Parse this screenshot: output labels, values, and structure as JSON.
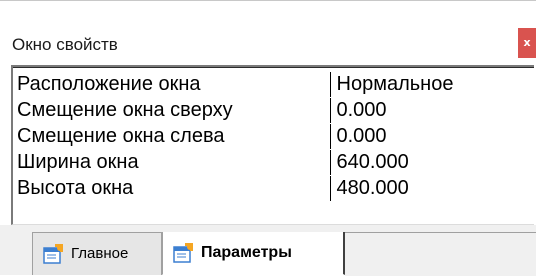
{
  "window": {
    "title": "Окно свойств",
    "close_label": "x"
  },
  "properties": [
    {
      "name": "Расположение окна",
      "value": "Нормальное"
    },
    {
      "name": "Смещение окна сверху",
      "value": "0.000"
    },
    {
      "name": "Смещение окна слева",
      "value": "0.000"
    },
    {
      "name": "Ширина окна",
      "value": "640.000"
    },
    {
      "name": "Высота окна",
      "value": "480.000"
    }
  ],
  "tabs": [
    {
      "label": "Главное",
      "icon": "properties-icon",
      "active": false
    },
    {
      "label": "Параметры",
      "icon": "properties-icon",
      "active": true
    }
  ],
  "colors": {
    "close_button": "#d9534f",
    "icon_orange": "#f5a623",
    "icon_blue": "#3c7fd1"
  }
}
